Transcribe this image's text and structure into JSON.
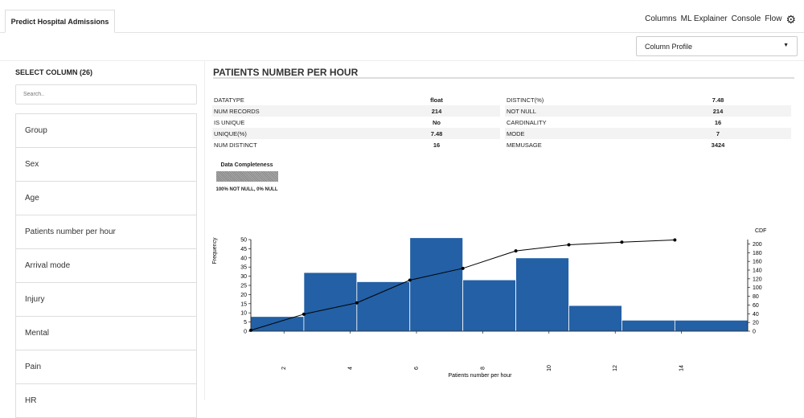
{
  "tab": {
    "label": "Predict Hospital Admissions"
  },
  "nav": {
    "columns": "Columns",
    "ml_explainer": "ML Explainer",
    "console": "Console",
    "flow": "Flow"
  },
  "view_select": {
    "value": "Column Profile"
  },
  "sidebar": {
    "title": "SELECT COLUMN (26)",
    "search_placeholder": "Search..",
    "items": [
      "Group",
      "Sex",
      "Age",
      "Patients number per hour",
      "Arrival mode",
      "Injury",
      "Mental",
      "Pain",
      "HR"
    ]
  },
  "main": {
    "title": "PATIENTS NUMBER PER HOUR"
  },
  "stats_left": [
    {
      "label": "DATATYPE",
      "value": "float"
    },
    {
      "label": "NUM RECORDS",
      "value": "214"
    },
    {
      "label": "IS UNIQUE",
      "value": "No"
    },
    {
      "label": "UNIQUE(%)",
      "value": "7.48"
    },
    {
      "label": "NUM DISTINCT",
      "value": "16"
    }
  ],
  "stats_right": [
    {
      "label": "DISTINCT(%)",
      "value": "7.48"
    },
    {
      "label": "NOT NULL",
      "value": "214"
    },
    {
      "label": "CARDINALITY",
      "value": "16"
    },
    {
      "label": "MODE",
      "value": "7"
    },
    {
      "label": "MEMUSAGE",
      "value": "3424"
    }
  ],
  "completeness": {
    "title": "Data Completeness",
    "label": "100% NOT NULL, 0% NULL",
    "not_null_fraction": 1.0
  },
  "colors": {
    "bar": "#2360a5",
    "line": "#000000"
  },
  "chart_data": {
    "type": "bar",
    "xlabel": "Patients number per hour",
    "ylabel": "Frequency",
    "y2label": "CDF",
    "x_ticks": [
      "2",
      "4",
      "6",
      "8",
      "10",
      "12",
      "14"
    ],
    "y_ticks": [
      "0",
      "5",
      "10",
      "15",
      "20",
      "25",
      "30",
      "35",
      "40",
      "45",
      "50"
    ],
    "y2_ticks": [
      "0",
      "20",
      "40",
      "60",
      "80",
      "100",
      "120",
      "140",
      "160",
      "180",
      "200"
    ],
    "xlim": [
      1,
      16
    ],
    "ylim": [
      0,
      50
    ],
    "y2lim": [
      0,
      210
    ],
    "bins": [
      {
        "x0": 1,
        "x1": 2.6,
        "count": 8
      },
      {
        "x0": 2.6,
        "x1": 4.2,
        "count": 32
      },
      {
        "x0": 4.2,
        "x1": 5.8,
        "count": 27
      },
      {
        "x0": 5.8,
        "x1": 7.4,
        "count": 51
      },
      {
        "x0": 7.4,
        "x1": 9.0,
        "count": 28
      },
      {
        "x0": 9.0,
        "x1": 10.6,
        "count": 40
      },
      {
        "x0": 10.6,
        "x1": 12.2,
        "count": 14
      },
      {
        "x0": 12.2,
        "x1": 13.8,
        "count": 6
      },
      {
        "x0": 13.8,
        "x1": 16,
        "count": 6
      }
    ],
    "cdf": [
      {
        "x": 1.0,
        "y": 2
      },
      {
        "x": 2.6,
        "y": 39
      },
      {
        "x": 4.2,
        "y": 65
      },
      {
        "x": 5.8,
        "y": 117
      },
      {
        "x": 7.4,
        "y": 144
      },
      {
        "x": 9.0,
        "y": 184
      },
      {
        "x": 10.6,
        "y": 198
      },
      {
        "x": 12.2,
        "y": 204
      },
      {
        "x": 13.8,
        "y": 209
      }
    ]
  }
}
